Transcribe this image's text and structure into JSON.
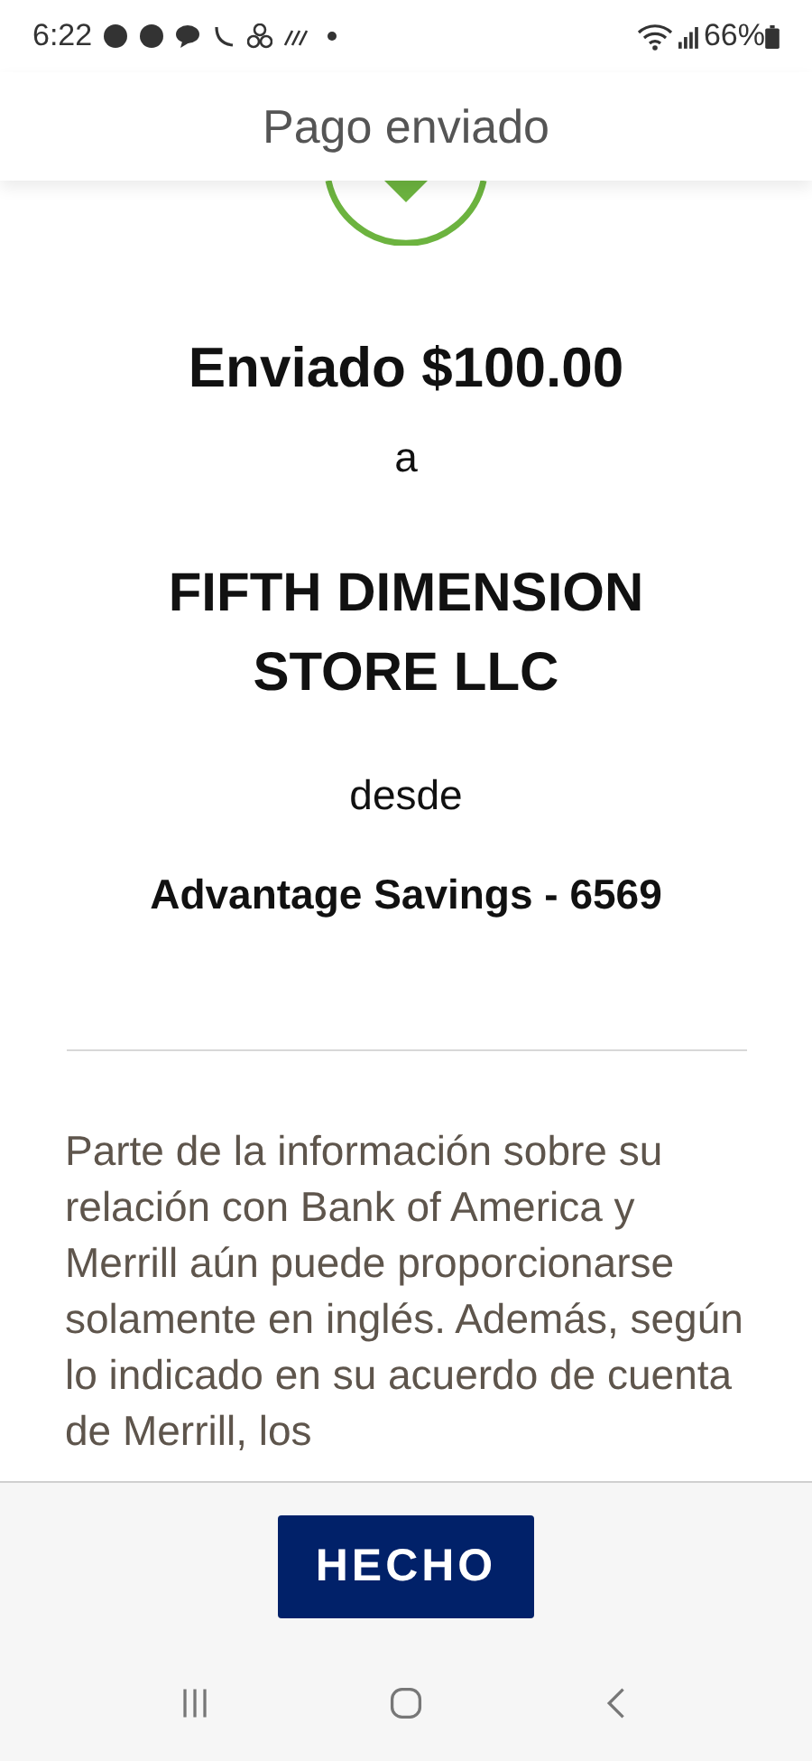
{
  "status_bar": {
    "time": "6:22",
    "battery": "66%"
  },
  "header": {
    "title": "Pago enviado"
  },
  "confirmation": {
    "amount_line": "Enviado $100.00",
    "to_word": "a",
    "payee": "FIFTH DIMENSION STORE LLC",
    "from_word": "desde",
    "account": "Advantage Savings - 6569"
  },
  "disclaimer": "Parte de la información sobre su relación con Bank of America y Merrill aún puede proporcionarse solamente en inglés. Además, según lo indicado en su acuerdo de cuenta de Merrill, los",
  "done_button": {
    "label": "HECHO"
  }
}
